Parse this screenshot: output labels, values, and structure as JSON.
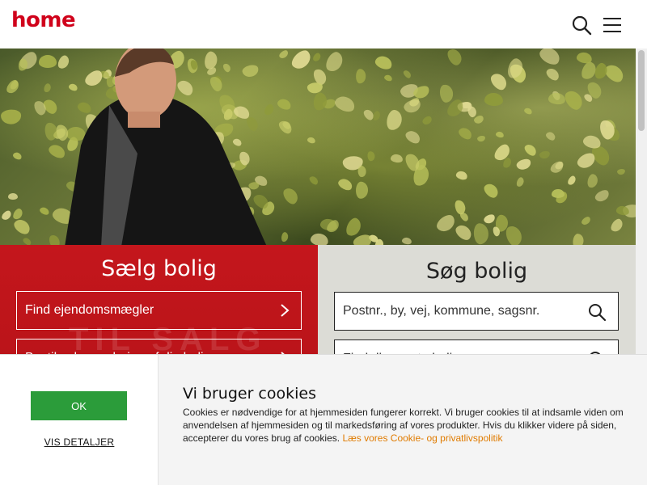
{
  "header": {
    "logo_text": "home",
    "search_icon": "search-icon",
    "menu_icon": "hamburger-menu-icon"
  },
  "sell": {
    "title": "Sælg bolig",
    "items": [
      {
        "label": "Find ejendomsmægler"
      },
      {
        "label": "Bestil salgsvurdering af din bolig"
      }
    ],
    "watermark": "TIL SALG"
  },
  "search": {
    "title": "Søg bolig",
    "placeholder_1": "Postnr., by, vej, kommune, sagsnr.",
    "placeholder_2": "Find din næste bolig"
  },
  "cookie": {
    "ok_label": "OK",
    "details_label": "VIS DETALJER",
    "title": "Vi bruger cookies",
    "text": "Cookies er nødvendige for at hjemmesiden fungerer korrekt. Vi bruger cookies til at indsamle viden om anvendelsen af hjemmesiden og til markedsføring af vores produkter. Hvis du klikker videre på siden, accepterer du vores brug af cookies.",
    "link_text": "Læs vores Cookie- og privatlivspolitik"
  },
  "colors": {
    "brand_red": "#c4161c",
    "ok_green": "#2b9c3a",
    "link_orange": "#e07b00"
  }
}
